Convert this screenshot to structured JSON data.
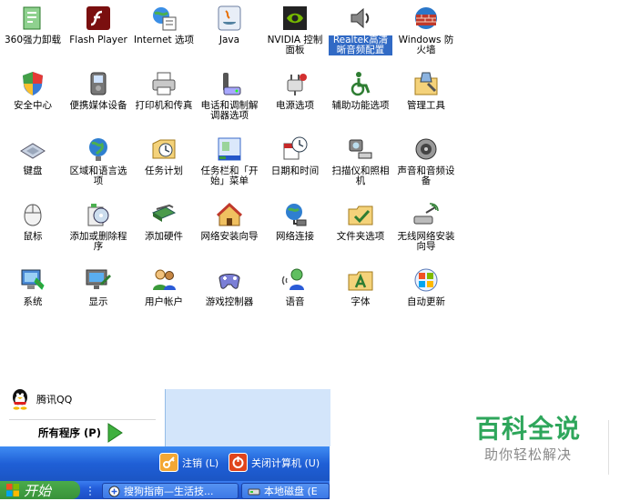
{
  "control_panel": {
    "items": [
      {
        "label": "360强力卸载",
        "icon": "uninstaller-icon"
      },
      {
        "label": "Flash Player",
        "icon": "flash-icon"
      },
      {
        "label": "Internet 选项",
        "icon": "internet-options-icon"
      },
      {
        "label": "Java",
        "icon": "java-icon"
      },
      {
        "label": "NVIDIA 控制面板",
        "icon": "nvidia-icon"
      },
      {
        "label": "Realtek高清晰音频配置",
        "icon": "speaker-icon"
      },
      {
        "label": "Windows 防火墙",
        "icon": "firewall-icon"
      },
      {
        "label": "安全中心",
        "icon": "shield-icon"
      },
      {
        "label": "便携媒体设备",
        "icon": "media-device-icon"
      },
      {
        "label": "打印机和传真",
        "icon": "printer-icon"
      },
      {
        "label": "电话和调制解调器选项",
        "icon": "phone-modem-icon"
      },
      {
        "label": "电源选项",
        "icon": "power-icon"
      },
      {
        "label": "辅助功能选项",
        "icon": "accessibility-icon"
      },
      {
        "label": "管理工具",
        "icon": "admin-tools-icon"
      },
      {
        "label": "键盘",
        "icon": "keyboard-icon"
      },
      {
        "label": "区域和语言选项",
        "icon": "globe-icon"
      },
      {
        "label": "任务计划",
        "icon": "scheduled-tasks-icon"
      },
      {
        "label": "任务栏和「开始」菜单",
        "icon": "taskbar-icon"
      },
      {
        "label": "日期和时间",
        "icon": "clock-icon"
      },
      {
        "label": "扫描仪和照相机",
        "icon": "scanner-icon"
      },
      {
        "label": "声音和音频设备",
        "icon": "sound-icon"
      },
      {
        "label": "鼠标",
        "icon": "mouse-icon"
      },
      {
        "label": "添加或删除程序",
        "icon": "add-remove-icon"
      },
      {
        "label": "添加硬件",
        "icon": "hardware-icon"
      },
      {
        "label": "网络安装向导",
        "icon": "network-wizard-icon"
      },
      {
        "label": "网络连接",
        "icon": "network-icon"
      },
      {
        "label": "文件夹选项",
        "icon": "folder-options-icon"
      },
      {
        "label": "无线网络安装向导",
        "icon": "wireless-icon"
      },
      {
        "label": "系统",
        "icon": "system-icon"
      },
      {
        "label": "显示",
        "icon": "display-icon"
      },
      {
        "label": "用户帐户",
        "icon": "users-icon"
      },
      {
        "label": "游戏控制器",
        "icon": "gamepad-icon"
      },
      {
        "label": "语音",
        "icon": "speech-icon"
      },
      {
        "label": "字体",
        "icon": "fonts-icon"
      },
      {
        "label": "自动更新",
        "icon": "windows-update-icon"
      }
    ],
    "selected_index": 5
  },
  "start_menu": {
    "qq_label": "腾讯QQ",
    "all_programs_label": "所有程序 (P)",
    "logoff_label": "注销 (L)",
    "shutdown_label": "关闭计算机 (U)"
  },
  "taskbar": {
    "start_label": "开始",
    "tasks": [
      {
        "label": "搜狗指南—生活技..."
      },
      {
        "label": "本地磁盘 (E"
      }
    ]
  },
  "watermark": {
    "title": "百科全说",
    "subtitle": "助你轻松解决"
  },
  "colors": {
    "selection": "#316ac5",
    "xp_blue": "#245edb",
    "start_green": "#3c963c",
    "watermark_green": "#2ea65b"
  }
}
